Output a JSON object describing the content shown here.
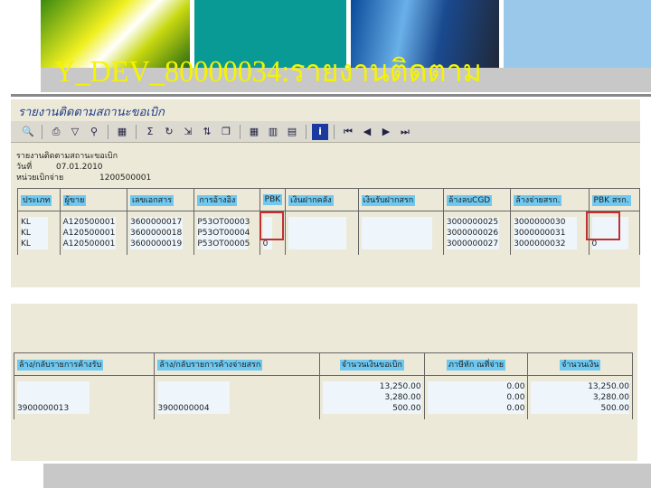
{
  "header": {
    "title": "Y_DEV_80000034:รายงานติดตาม"
  },
  "report": {
    "title": "รายงานติดตามสถานะขอเบิก",
    "heading": "รายงานติดตามสถานะขอเบิก",
    "date_label": "วันที่",
    "date": "07.01.2010",
    "unit_label": "หน่วยเบิกจ่าย",
    "unit": "1200500001"
  },
  "toolbar": [
    "details-icon",
    "print-icon",
    "filter-icon",
    "filter-set-icon",
    "excel-icon",
    "sum-icon",
    "subtotal-icon",
    "export-icon",
    "sort-icon",
    "copy-icon",
    "layout-icon",
    "column-icon",
    "select-icon",
    "info-icon",
    "first-page-icon",
    "prev-page-icon",
    "next-page-icon",
    "last-page-icon"
  ],
  "table1": {
    "headers": [
      "ประเภท",
      "ผู้ขาย",
      "เลขเอกสาร",
      "การอ้างอิง",
      "PBK",
      "เงินฝากคลัง",
      "เงินรับฝากสรก",
      "ล้างลบCGD",
      "ล้างจ่ายสรก.",
      "PBK สรก."
    ],
    "rows": [
      [
        "KL",
        "A120500001",
        "3600000017",
        "P53OT00003",
        "",
        "",
        "",
        "3000000025",
        "3000000030",
        ""
      ],
      [
        "KL",
        "A120500001",
        "3600000018",
        "P53OT00004",
        "",
        "",
        "",
        "3000000026",
        "3000000031",
        ""
      ],
      [
        "KL",
        "A120500001",
        "3600000019",
        "P53OT00005",
        "0",
        "",
        "",
        "3000000027",
        "3000000032",
        "0"
      ]
    ]
  },
  "table2": {
    "headers": [
      "ล้าง/กลับรายการค้างรับ",
      "ล้าง/กลับรายการค้างจ่ายสรก",
      "จำนวนเงินขอเบิก",
      "ภาษีหัก ณที่จ่าย",
      "จำนวนเงิน"
    ],
    "rows": [
      [
        "",
        "",
        "13,250.00",
        "0.00",
        "13,250.00"
      ],
      [
        "",
        "",
        "3,280.00",
        "0.00",
        "3,280.00"
      ],
      [
        "3900000013",
        "3900000004",
        "500.00",
        "0.00",
        "500.00"
      ]
    ]
  }
}
